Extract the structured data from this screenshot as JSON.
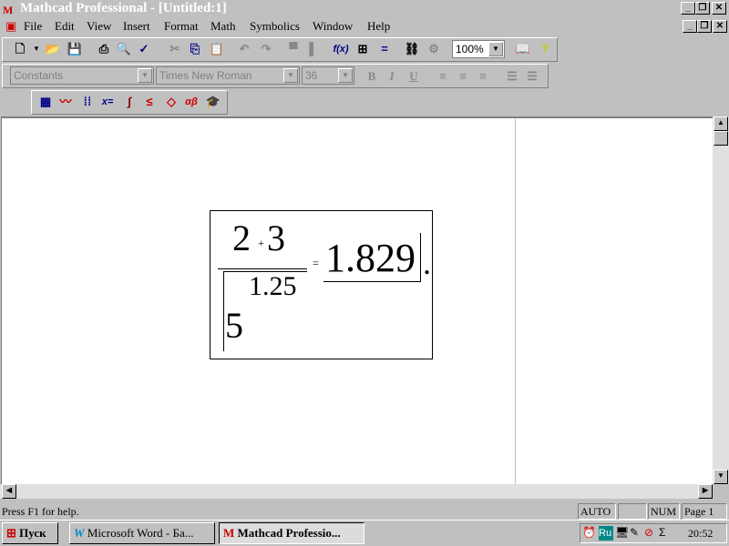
{
  "window": {
    "title": "Mathcad Professional - [Untitled:1]"
  },
  "menu": [
    "File",
    "Edit",
    "View",
    "Insert",
    "Format",
    "Math",
    "Symbolics",
    "Window",
    "Help"
  ],
  "toolbar": {
    "zoom": "100%",
    "fx": "f(x)",
    "eq": "="
  },
  "format_bar": {
    "style": "Constants",
    "font": "Times New Roman",
    "size": "36",
    "bold": "B",
    "italic": "I",
    "underline": "U"
  },
  "math_bar": {
    "xeq": "x=",
    "greek": "αβ"
  },
  "worksheet": {
    "numerator_a": "2",
    "op": "+",
    "numerator_b": "3",
    "radicand": "1.25",
    "root_index": "5",
    "equals": "=",
    "result": "1.829",
    "period": "."
  },
  "status": {
    "help": "Press F1 for help.",
    "auto": "AUTO",
    "num": "NUM",
    "page": "Page 1"
  },
  "taskbar": {
    "start": "Пуск",
    "word": "Microsoft Word - Ба...",
    "mathcad": "Mathcad Professio...",
    "lang": "Ru",
    "clock": "20:52"
  }
}
